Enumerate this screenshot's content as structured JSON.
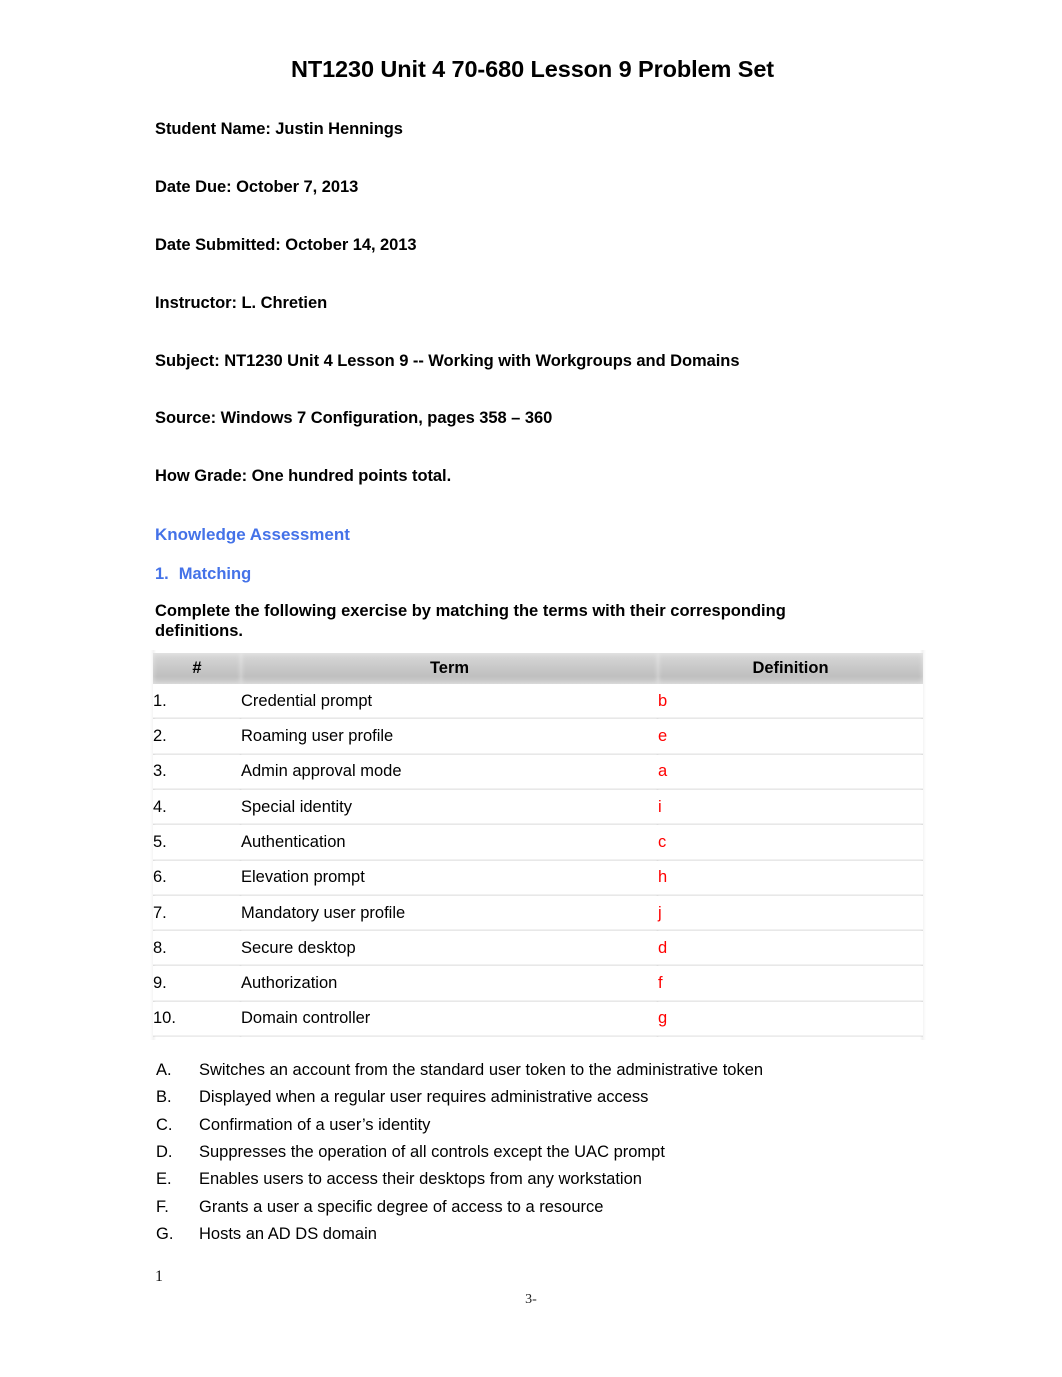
{
  "document": {
    "title": "NT1230 Unit 4 70-680 Lesson 9 Problem Set",
    "header_lines": [
      "Student Name: Justin Hennings",
      "Date Due: October 7, 2013",
      "Date Submitted: October 14, 2013",
      "Instructor: L. Chretien",
      "Subject: NT1230 Unit 4 Lesson 9 -- Working with Workgroups and Domains",
      "Source: Windows 7 Configuration, pages 358 – 360",
      "How Grade: One hundred points total."
    ],
    "section_heading": "Knowledge Assessment",
    "subsection": {
      "number": "1.",
      "label": "Matching"
    },
    "instruction": "Complete the following exercise by matching the terms with their corresponding definitions.",
    "colors": {
      "heading_blue": "#4472E8",
      "answer_red": "#FF0000",
      "table_header_gray": "#c9c9c9"
    }
  },
  "matching_table": {
    "columns": [
      "#",
      "Term",
      "Definition"
    ],
    "rows": [
      {
        "num": "1.",
        "term": "Credential prompt",
        "definition": "b"
      },
      {
        "num": "2.",
        "term": "Roaming user profile",
        "definition": "e"
      },
      {
        "num": "3.",
        "term": "Admin approval mode",
        "definition": "a"
      },
      {
        "num": "4.",
        "term": "Special identity",
        "definition": "i"
      },
      {
        "num": "5.",
        "term": "Authentication",
        "definition": "c"
      },
      {
        "num": "6.",
        "term": "Elevation prompt",
        "definition": "h"
      },
      {
        "num": "7.",
        "term": "Mandatory user profile",
        "definition": "j"
      },
      {
        "num": "8.",
        "term": "Secure desktop",
        "definition": "d"
      },
      {
        "num": "9.",
        "term": "Authorization",
        "definition": "f"
      },
      {
        "num": "10.",
        "term": "Domain controller",
        "definition": "g"
      }
    ]
  },
  "definitions": [
    {
      "letter": "A.",
      "text": "Switches an account from the standard user token to the administrative token"
    },
    {
      "letter": "B.",
      "text": "Displayed when a regular user requires administrative access"
    },
    {
      "letter": "C.",
      "text": "Confirmation of a user’s identity"
    },
    {
      "letter": "D.",
      "text": "Suppresses the operation of all controls except the UAC prompt"
    },
    {
      "letter": "E.",
      "text": "Enables users to access their desktops from any workstation"
    },
    {
      "letter": "F.",
      "text": "Grants a user a specific degree of access to a resource"
    },
    {
      "letter": "G.",
      "text": "Hosts an AD DS domain"
    }
  ],
  "footer": {
    "left_number": "1",
    "center_number": "3-"
  }
}
